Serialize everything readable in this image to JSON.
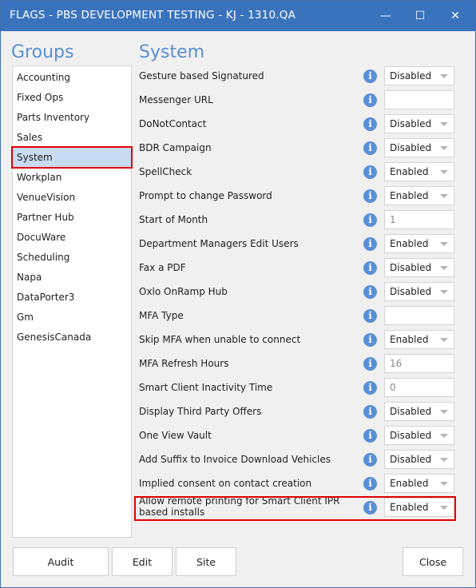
{
  "window": {
    "title": "FLAGS - PBS DEVELOPMENT TESTING - KJ - 1310.QA",
    "minimize_glyph": "—",
    "maximize_glyph": "☐",
    "close_glyph": "✕"
  },
  "groups": {
    "header": "Groups",
    "items": [
      "Accounting",
      "Fixed Ops",
      "Parts Inventory",
      "Sales",
      "System",
      "Workplan",
      "VenueVision",
      "Partner Hub",
      "DocuWare",
      "Scheduling",
      "Napa",
      "DataPorter3",
      "Gm",
      "GenesisCanada"
    ],
    "selected": "System"
  },
  "settings": {
    "header": "System",
    "info_glyph": "i",
    "rows": [
      {
        "label": "Gesture based Signatured",
        "value": "Disabled",
        "control": "dropdown"
      },
      {
        "label": "Messenger URL",
        "value": "",
        "control": "text"
      },
      {
        "label": "DoNotContact",
        "value": "Disabled",
        "control": "dropdown"
      },
      {
        "label": "BDR Campaign",
        "value": "Disabled",
        "control": "dropdown"
      },
      {
        "label": "SpellCheck",
        "value": "Enabled",
        "control": "dropdown"
      },
      {
        "label": "Prompt to change Password",
        "value": "Enabled",
        "control": "dropdown"
      },
      {
        "label": "Start of Month",
        "value": "1",
        "control": "text"
      },
      {
        "label": "Department Managers Edit Users",
        "value": "Enabled",
        "control": "dropdown"
      },
      {
        "label": "Fax a PDF",
        "value": "Disabled",
        "control": "dropdown"
      },
      {
        "label": "Oxlo OnRamp Hub",
        "value": "Disabled",
        "control": "dropdown"
      },
      {
        "label": "MFA Type",
        "value": "",
        "control": "text"
      },
      {
        "label": "Skip MFA when unable to connect",
        "value": "Enabled",
        "control": "dropdown"
      },
      {
        "label": "MFA Refresh Hours",
        "value": "16",
        "control": "text"
      },
      {
        "label": "Smart Client Inactivity Time",
        "value": "0",
        "control": "text"
      },
      {
        "label": "Display Third Party Offers",
        "value": "Disabled",
        "control": "dropdown"
      },
      {
        "label": "One View Vault",
        "value": "Disabled",
        "control": "dropdown"
      },
      {
        "label": "Add Suffix to Invoice Download Vehicles",
        "value": "Disabled",
        "control": "dropdown"
      },
      {
        "label": "Implied consent on contact creation",
        "value": "Enabled",
        "control": "dropdown"
      },
      {
        "label": "Allow remote printing for Smart Client IPR based installs",
        "value": "Enabled",
        "control": "dropdown"
      }
    ]
  },
  "footer": {
    "audit_label": "Audit",
    "edit_label": "Edit",
    "site_label": "Site",
    "close_label": "Close"
  }
}
